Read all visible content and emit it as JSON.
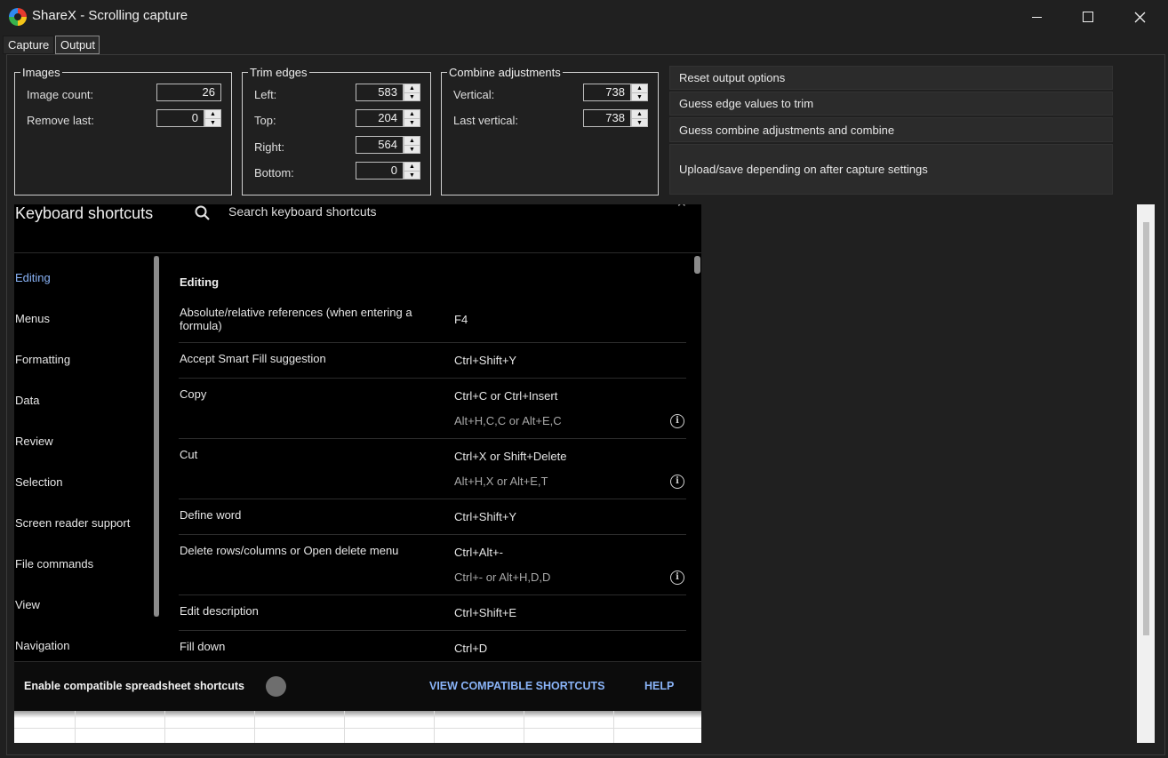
{
  "window": {
    "title": "ShareX - Scrolling capture"
  },
  "tabs": [
    {
      "label": "Capture"
    },
    {
      "label": "Output"
    }
  ],
  "images_group": {
    "legend": "Images",
    "image_count_label": "Image count:",
    "image_count_value": "26",
    "remove_last_label": "Remove last:",
    "remove_last_value": "0"
  },
  "trim_group": {
    "legend": "Trim edges",
    "left_label": "Left:",
    "left_value": "583",
    "top_label": "Top:",
    "top_value": "204",
    "right_label": "Right:",
    "right_value": "564",
    "bottom_label": "Bottom:",
    "bottom_value": "0"
  },
  "combine_group": {
    "legend": "Combine adjustments",
    "vertical_label": "Vertical:",
    "vertical_value": "738",
    "last_vertical_label": "Last vertical:",
    "last_vertical_value": "738"
  },
  "actions": {
    "reset": "Reset output options",
    "guess_edges": "Guess edge values to trim",
    "guess_combine": "Guess combine adjustments and combine",
    "upload": "Upload/save depending on after capture settings"
  },
  "preview": {
    "title": "Keyboard shortcuts",
    "search_placeholder": "Search keyboard shortcuts",
    "categories": [
      "Editing",
      "Menus",
      "Formatting",
      "Data",
      "Review",
      "Selection",
      "Screen reader support",
      "File commands",
      "View",
      "Navigation"
    ],
    "section_heading": "Editing",
    "shortcuts": [
      {
        "name": "Absolute/relative references (when entering a formula)",
        "key": "F4"
      },
      {
        "name": "Accept Smart Fill suggestion",
        "key": "Ctrl+Shift+Y"
      },
      {
        "name": "Copy",
        "key": "Ctrl+C or Ctrl+Insert",
        "alt": "Alt+H,C,C or Alt+E,C"
      },
      {
        "name": "Cut",
        "key": "Ctrl+X or Shift+Delete",
        "alt": "Alt+H,X or Alt+E,T"
      },
      {
        "name": "Define word",
        "key": "Ctrl+Shift+Y"
      },
      {
        "name": "Delete rows/columns or Open delete menu",
        "key": "Ctrl+Alt+-",
        "alt": "Ctrl+- or Alt+H,D,D"
      },
      {
        "name": "Edit description",
        "key": "Ctrl+Shift+E"
      },
      {
        "name": "Fill down",
        "key": "Ctrl+D"
      }
    ],
    "compat_label": "Enable compatible spreadsheet shortcuts",
    "view_compatible": "VIEW COMPATIBLE SHORTCUTS",
    "help": "HELP"
  }
}
